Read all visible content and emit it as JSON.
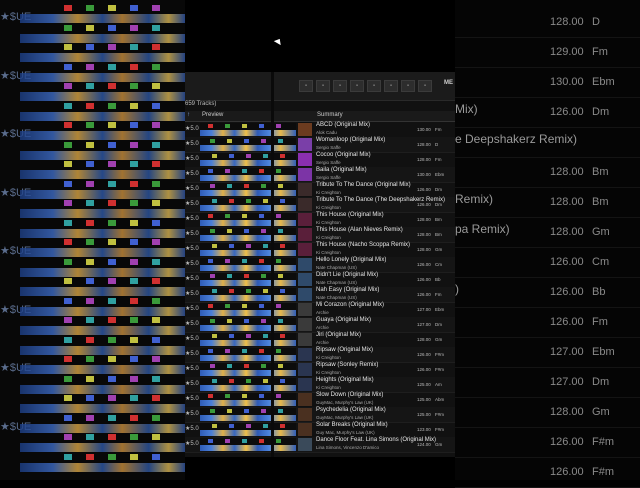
{
  "track_count_label": "659 Tracks)",
  "toolbar": {
    "me_label": "ME"
  },
  "columns": {
    "preview": "Preview",
    "summary": "Summary",
    "sort_arrow": "↑"
  },
  "rating_label": "★5.0",
  "tracks": [
    {
      "title": "ABCD (Original Mix)",
      "artist": "Alok Cadu",
      "bpm": "130.00",
      "key": "Fm",
      "art": "#6b3b1f"
    },
    {
      "title": "Womanloop (Original Mix)",
      "artist": "Sergio Saffe",
      "bpm": "128.00",
      "key": "D",
      "art": "#7a3fa8"
    },
    {
      "title": "Cocoo (Original Mix)",
      "artist": "Sergio Saffe",
      "bpm": "128.00",
      "key": "Fm",
      "art": "#8a2fb0"
    },
    {
      "title": "Baila (Original Mix)",
      "artist": "Sergio Saffe",
      "bpm": "130.00",
      "key": "Ebm",
      "art": "#7c34a6"
    },
    {
      "title": "Tribute To The Dance (Original Mix)",
      "artist": "Ki Creighton",
      "bpm": "126.00",
      "key": "Dm",
      "art": "#3a2a2a"
    },
    {
      "title": "Tribute To The Dance (The Deepshakerz Remix)",
      "artist": "Ki Creighton",
      "bpm": "126.00",
      "key": "Dm",
      "art": "#3a2a2a"
    },
    {
      "title": "This House (Original Mix)",
      "artist": "Ki Creighton",
      "bpm": "128.00",
      "key": "Bm",
      "art": "#5a1f3a"
    },
    {
      "title": "This House (Alan Nieves Remix)",
      "artist": "Ki Creighton",
      "bpm": "128.00",
      "key": "Bm",
      "art": "#5a1f3a"
    },
    {
      "title": "This House (Nacho Scoppa Remix)",
      "artist": "Ki Creighton",
      "bpm": "128.00",
      "key": "Gm",
      "art": "#5a1f3a"
    },
    {
      "title": "Hello Lonely (Original Mix)",
      "artist": "Nate Chapman (US)",
      "bpm": "126.00",
      "key": "Cm",
      "art": "#2f4a6a"
    },
    {
      "title": "Didn't Lie (Original Mix)",
      "artist": "Nate Chapman (US)",
      "bpm": "126.00",
      "key": "Bb",
      "art": "#2f4a6a"
    },
    {
      "title": "Nah Easy (Original Mix)",
      "artist": "Nate Chapman (US)",
      "bpm": "126.00",
      "key": "Fm",
      "art": "#2f4a6a"
    },
    {
      "title": "Mi Corazon (Original Mix)",
      "artist": "Archie",
      "bpm": "127.00",
      "key": "Ebm",
      "art": "#3a3a3a"
    },
    {
      "title": "Guaya (Original Mix)",
      "artist": "Archie",
      "bpm": "127.00",
      "key": "Dm",
      "art": "#3a3a3a"
    },
    {
      "title": "Jiri (Original Mix)",
      "artist": "Archie",
      "bpm": "128.00",
      "key": "Gm",
      "art": "#3a3a3a"
    },
    {
      "title": "Ripsaw (Original Mix)",
      "artist": "Ki Creighton",
      "bpm": "126.00",
      "key": "F#m",
      "art": "#2a3550"
    },
    {
      "title": "Ripsaw (Sonley Remix)",
      "artist": "Ki Creighton",
      "bpm": "126.00",
      "key": "F#m",
      "art": "#2a3550"
    },
    {
      "title": "Heights (Original Mix)",
      "artist": "Ki Creighton",
      "bpm": "125.00",
      "key": "Am",
      "art": "#2a3550"
    },
    {
      "title": "Slow Down (Original Mix)",
      "artist": "GuyMac, Murphy's Law (UK)",
      "bpm": "125.00",
      "key": "Abm",
      "art": "#4a3020"
    },
    {
      "title": "Psychedelia (Original Mix)",
      "artist": "GuyMac, Murphy's Law (UK)",
      "bpm": "125.00",
      "key": "F#m",
      "art": "#4a3020"
    },
    {
      "title": "Solar Breaks (Original Mix)",
      "artist": "Guy Mac, Murphy's Law (UK)",
      "bpm": "123.00",
      "key": "F#m",
      "art": "#4a3020"
    },
    {
      "title": "Dance Floor Feat. Lina Simons (Original Mix)",
      "artist": "Lina Simons, Vincenzo D'amico",
      "bpm": "124.00",
      "key": "Gm",
      "art": "#3a4a5a"
    }
  ],
  "right_bg": [
    {
      "title": "",
      "bpm": "128.00",
      "key": "D"
    },
    {
      "title": "",
      "bpm": "129.00",
      "key": "Fm"
    },
    {
      "title": "",
      "bpm": "130.00",
      "key": "Ebm"
    },
    {
      "title": "Mix)",
      "bpm": "126.00",
      "key": "Dm"
    },
    {
      "title": "e Deepshakerz Remix)",
      "bpm": "",
      "key": ""
    },
    {
      "title": "",
      "bpm": "128.00",
      "key": "Bm"
    },
    {
      "title": "Remix)",
      "bpm": "128.00",
      "key": "Bm"
    },
    {
      "title": "pa Remix)",
      "bpm": "128.00",
      "key": "Gm"
    },
    {
      "title": "",
      "bpm": "126.00",
      "key": "Cm"
    },
    {
      "title": ")",
      "bpm": "126.00",
      "key": "Bb"
    },
    {
      "title": "",
      "bpm": "126.00",
      "key": "Fm"
    },
    {
      "title": "",
      "bpm": "127.00",
      "key": "Ebm"
    },
    {
      "title": "",
      "bpm": "127.00",
      "key": "Dm"
    },
    {
      "title": "",
      "bpm": "128.00",
      "key": "Gm"
    },
    {
      "title": "",
      "bpm": "126.00",
      "key": "F#m"
    },
    {
      "title": "",
      "bpm": "126.00",
      "key": "F#m"
    }
  ],
  "left_bg_label": "★$UE"
}
